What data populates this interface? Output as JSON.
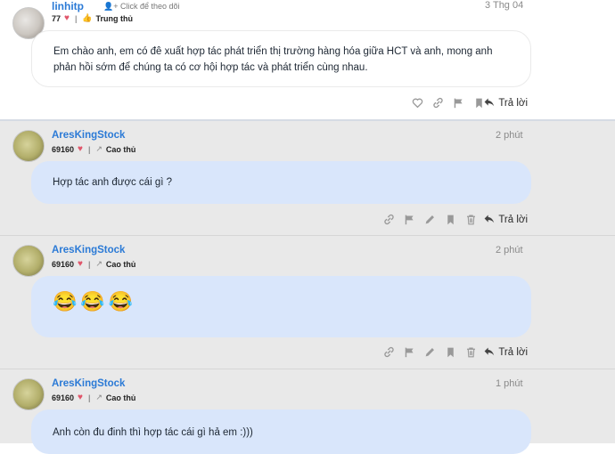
{
  "posts": [
    {
      "username": "linhitp",
      "follow_label": "Click để theo dõi",
      "points": "77",
      "rank": "Trung thủ",
      "time": "3 Thg 04",
      "text": "Em chào anh, em có đê xuất hợp tác phát triển thị trường hàng hóa giữa HCT và anh, mong anh phản hồi sớm để chúng ta có cơ hội hợp tác và phát triển cùng nhau.",
      "reply_label": "Trả lời"
    },
    {
      "username": "AresKingStock",
      "points": "69160",
      "rank": "Cao thủ",
      "time": "2 phút",
      "text": "Hợp tác anh được cái gì ?",
      "reply_label": "Trả lời"
    },
    {
      "username": "AresKingStock",
      "points": "69160",
      "rank": "Cao thủ",
      "time": "2 phút",
      "text": "😂😂😂",
      "reply_label": "Trả lời"
    },
    {
      "username": "AresKingStock",
      "points": "69160",
      "rank": "Cao thủ",
      "time": "1 phút",
      "text": "Anh còn đu đinh thì hợp tác cái gì hả em :)))"
    }
  ],
  "icons": {
    "heart": "heart-icon",
    "link": "link-icon",
    "flag": "flag-icon",
    "bookmark": "bookmark-icon",
    "edit": "pencil-icon",
    "delete": "trash-icon",
    "reply": "reply-arrow-icon",
    "rank": "rank-icon",
    "follow": "user-plus-icon"
  },
  "colors": {
    "username": "#2b7ad6",
    "bubble_blue": "#d9e6fb",
    "heart": "#e0556a",
    "post_bg_gray": "#e9e9e9"
  }
}
